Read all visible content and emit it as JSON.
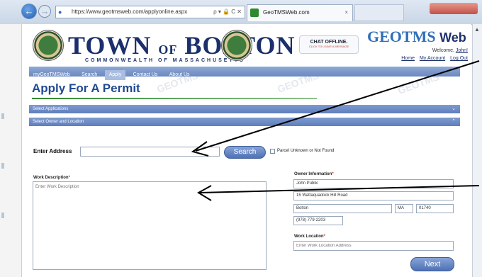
{
  "browser": {
    "url": "https://www.geotmsweb.com/applyonline.aspx",
    "address_controls": "ρ ▾ 🔒 C ✕",
    "tab_title": "GeoTMSWeb.com",
    "tab_close": "×"
  },
  "header": {
    "town_word": "TOWN",
    "of_word": "OF",
    "town_name": "BOLTON",
    "commonwealth": "COMMONWEALTH OF MASSACHUSETTS",
    "chat_title": "CHAT OFFLINE.",
    "chat_sub": "CLICK TO LEAVE A MESSAGE",
    "geo_brand": "GEOTMS",
    "geo_web": "Web",
    "welcome_prefix": "Welcome,",
    "welcome_user": "John!",
    "links": {
      "home": "Home",
      "my_account": "My Account",
      "logout": "Log Out"
    }
  },
  "nav": {
    "items": [
      "myGeoTMSWeb",
      "Search",
      "Apply",
      "Contact Us",
      "About Us"
    ],
    "active": "Apply"
  },
  "page_title": "Apply For A Permit",
  "sections": {
    "select_applications": "Select Applications",
    "select_owner_location": "Select Owner and Location"
  },
  "form": {
    "address_label": "Enter Address",
    "address_value": "",
    "search_button": "Search",
    "parcel_unknown": "Parcel Unknown or Not Found",
    "work_description_label": "Work Description",
    "work_description_placeholder": "Enter Work Description",
    "owner_information_label": "Owner Information",
    "owner_name": "John Public",
    "owner_street": "15 Wattaquadock Hill Road",
    "owner_city": "Bolton",
    "owner_state": "MA",
    "owner_zip": "01740",
    "owner_phone": "(978) 779-2203",
    "work_location_label": "Work Location",
    "work_location_placeholder": "Enter Work Location Address",
    "next_button": "Next",
    "required_mark": "*"
  },
  "watermark": "GEOTMS",
  "colors": {
    "brand_blue": "#1b2f6b",
    "nav_blue": "#6b88bf",
    "accent_green": "#2f8a2f",
    "required_red": "#c0392b"
  }
}
